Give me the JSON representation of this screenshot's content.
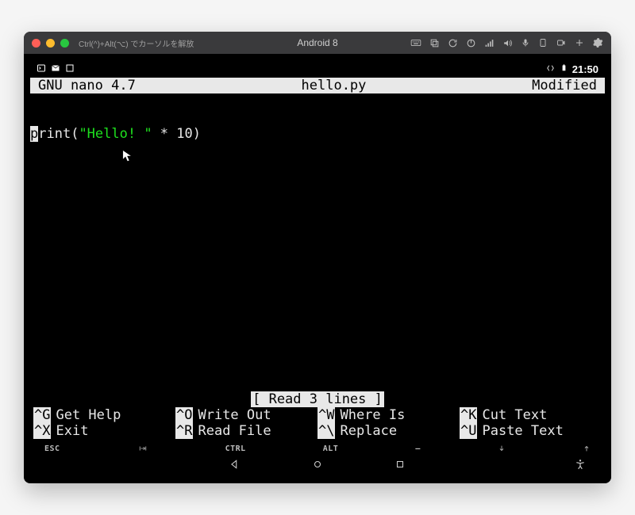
{
  "vm": {
    "hint": "Ctrl(^)+Alt(⌥) でカーソルを解放",
    "title": "Android 8"
  },
  "android_status": {
    "time": "21:50"
  },
  "nano": {
    "app": "GNU nano 4.7",
    "filename": "hello.py",
    "state": "Modified",
    "code_prefix_char": "p",
    "code_after_cursor": "rint(",
    "code_string": "\"Hello! \"",
    "code_tail": " * 10)",
    "status": "[ Read 3 lines ]",
    "shortcuts": [
      {
        "key": "^G",
        "label": "Get Help"
      },
      {
        "key": "^O",
        "label": "Write Out"
      },
      {
        "key": "^W",
        "label": "Where Is"
      },
      {
        "key": "^K",
        "label": "Cut Text"
      },
      {
        "key": "^X",
        "label": "Exit"
      },
      {
        "key": "^R",
        "label": "Read File"
      },
      {
        "key": "^\\",
        "label": "Replace"
      },
      {
        "key": "^U",
        "label": "Paste Text"
      }
    ]
  },
  "keyrow": {
    "esc": "ESC",
    "ctrl": "CTRL",
    "alt": "ALT",
    "dash": "—"
  }
}
